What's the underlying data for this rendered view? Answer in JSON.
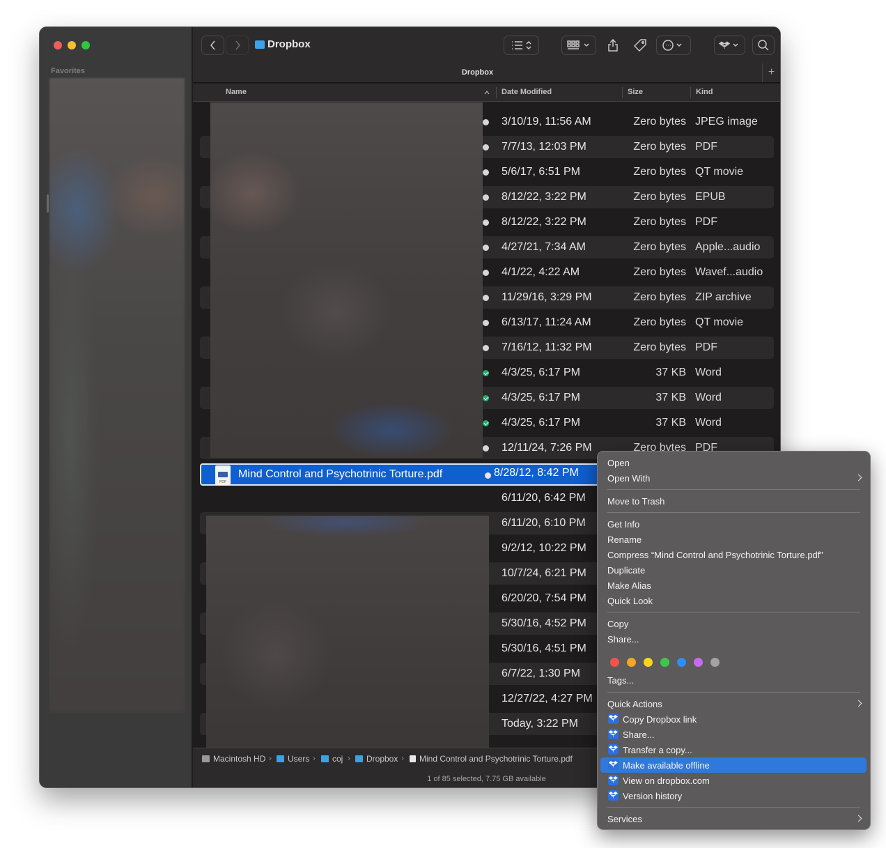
{
  "window": {
    "title": "Dropbox",
    "traffic_colors": [
      "#ee5f59",
      "#f6bf2f",
      "#2dc740"
    ]
  },
  "sidebar": {
    "heading": "Favorites"
  },
  "toolbar": {
    "title": "Dropbox"
  },
  "tab": {
    "label": "Dropbox",
    "add": "+"
  },
  "columns": {
    "name": "Name",
    "date": "Date Modified",
    "size": "Size",
    "kind": "Kind"
  },
  "rows": [
    {
      "date": "3/10/19, 11:56 AM",
      "size": "Zero bytes",
      "kind": "JPEG image",
      "status": "cloud"
    },
    {
      "date": "7/7/13, 12:03 PM",
      "size": "Zero bytes",
      "kind": "PDF",
      "status": "cloud"
    },
    {
      "date": "5/6/17, 6:51 PM",
      "size": "Zero bytes",
      "kind": "QT movie",
      "status": "cloud"
    },
    {
      "date": "8/12/22, 3:22 PM",
      "size": "Zero bytes",
      "kind": "EPUB",
      "status": "cloud"
    },
    {
      "date": "8/12/22, 3:22 PM",
      "size": "Zero bytes",
      "kind": "PDF",
      "status": "cloud"
    },
    {
      "date": "4/27/21, 7:34 AM",
      "size": "Zero bytes",
      "kind": "Apple...audio",
      "status": "cloud"
    },
    {
      "date": "4/1/22, 4:22 AM",
      "size": "Zero bytes",
      "kind": "Wavef...audio",
      "status": "cloud"
    },
    {
      "date": "11/29/16, 3:29 PM",
      "size": "Zero bytes",
      "kind": "ZIP archive",
      "status": "cloud"
    },
    {
      "date": "6/13/17, 11:24 AM",
      "size": "Zero bytes",
      "kind": "QT movie",
      "status": "cloud"
    },
    {
      "date": "7/16/12, 11:32 PM",
      "size": "Zero bytes",
      "kind": "PDF",
      "status": "cloud"
    },
    {
      "date": "4/3/25, 6:17 PM",
      "size": "37 KB",
      "kind": "Word",
      "status": "synced"
    },
    {
      "date": "4/3/25, 6:17 PM",
      "size": "37 KB",
      "kind": "Word",
      "status": "synced"
    },
    {
      "date": "4/3/25, 6:17 PM",
      "size": "37 KB",
      "kind": "Word",
      "status": "synced"
    },
    {
      "date": "12/11/24, 7:26 PM",
      "size": "Zero bytes",
      "kind": "PDF",
      "status": "cloud"
    }
  ],
  "selected": {
    "name": "Mind Control and Psychotrinic Torture.pdf",
    "date": "8/28/12, 8:42 PM"
  },
  "lower_rows": [
    {
      "date": "6/11/20, 6:42 PM"
    },
    {
      "date": "6/11/20, 6:10 PM"
    },
    {
      "date": "9/2/12, 10:22 PM"
    },
    {
      "date": "10/7/24, 6:21 PM"
    },
    {
      "date": "6/20/20, 7:54 PM"
    },
    {
      "date": "5/30/16, 4:52 PM"
    },
    {
      "date": "5/30/16, 4:51 PM"
    },
    {
      "date": "6/7/22, 1:30 PM"
    },
    {
      "date": "12/27/22, 4:27 PM"
    },
    {
      "date": "Today, 3:22 PM"
    }
  ],
  "pathbar": {
    "crumbs": [
      "Macintosh HD",
      "Users",
      "coj",
      "Dropbox",
      "Mind Control and Psychotrinic Torture.pdf"
    ],
    "separator": "›"
  },
  "status": {
    "text": "1 of 85 selected, 7.75 GB available"
  },
  "menu": {
    "open": "Open",
    "open_with": "Open With",
    "move_to_trash": "Move to Trash",
    "get_info": "Get Info",
    "rename": "Rename",
    "compress": "Compress “Mind Control and Psychotrinic Torture.pdf”",
    "duplicate": "Duplicate",
    "make_alias": "Make Alias",
    "quick_look": "Quick Look",
    "copy": "Copy",
    "share": "Share...",
    "tag_colors": [
      "#f2544d",
      "#f5a623",
      "#f8d51c",
      "#3ec74f",
      "#2f8ef5",
      "#c76af0",
      "#a3a3a3"
    ],
    "tags": "Tags...",
    "quick_actions": "Quick Actions",
    "copy_dropbox_link": "Copy Dropbox link",
    "dropbox_share": "Share...",
    "transfer_copy": "Transfer a copy...",
    "make_offline": "Make available offline",
    "view_on_dropbox": "View on dropbox.com",
    "version_history": "Version history",
    "services": "Services"
  }
}
